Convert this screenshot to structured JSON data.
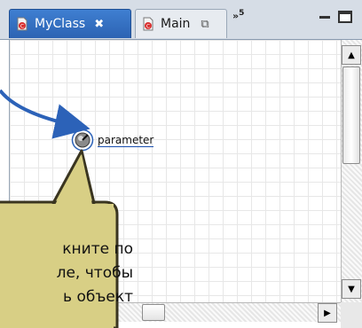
{
  "tabs": [
    {
      "label": "MyClass",
      "close": "✖",
      "active": true
    },
    {
      "label": "Main",
      "close": "⧉",
      "active": false
    }
  ],
  "overflow": {
    "mark": "»",
    "count": "5"
  },
  "element": {
    "label": "parameter"
  },
  "callout": {
    "lines": [
      "кните по",
      "ле, чтобы",
      "ь объект"
    ]
  },
  "colors": {
    "active_tab": "#3f7fd1",
    "arrow": "#2c62b8",
    "callout_fill": "#d8cf85"
  },
  "icons": {
    "tab": "class-icon",
    "element": "parameter-icon"
  }
}
